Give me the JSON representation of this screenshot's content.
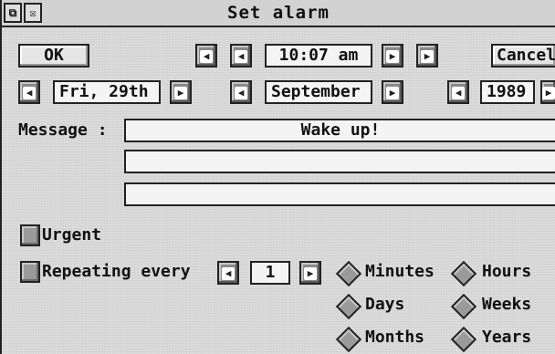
{
  "window": {
    "title": "Set alarm"
  },
  "titlebar": {
    "back_glyph": "⧉",
    "close_glyph": "☒"
  },
  "buttons": {
    "ok": "OK",
    "cancel": "Cancel"
  },
  "time": {
    "value": "10:07 am"
  },
  "date": {
    "day": "Fri, 29th",
    "month": "September",
    "year": "1989"
  },
  "message": {
    "label": "Message :",
    "line1": "Wake up!",
    "line2": "",
    "line3": ""
  },
  "urgent": {
    "label": "Urgent",
    "checked": false
  },
  "repeat": {
    "label": "Repeating every",
    "count": "1",
    "checked": false,
    "units": [
      "Minutes",
      "Hours",
      "Days",
      "Weeks",
      "Months",
      "Years"
    ]
  },
  "arrows": {
    "left": "◀",
    "right": "▶"
  }
}
